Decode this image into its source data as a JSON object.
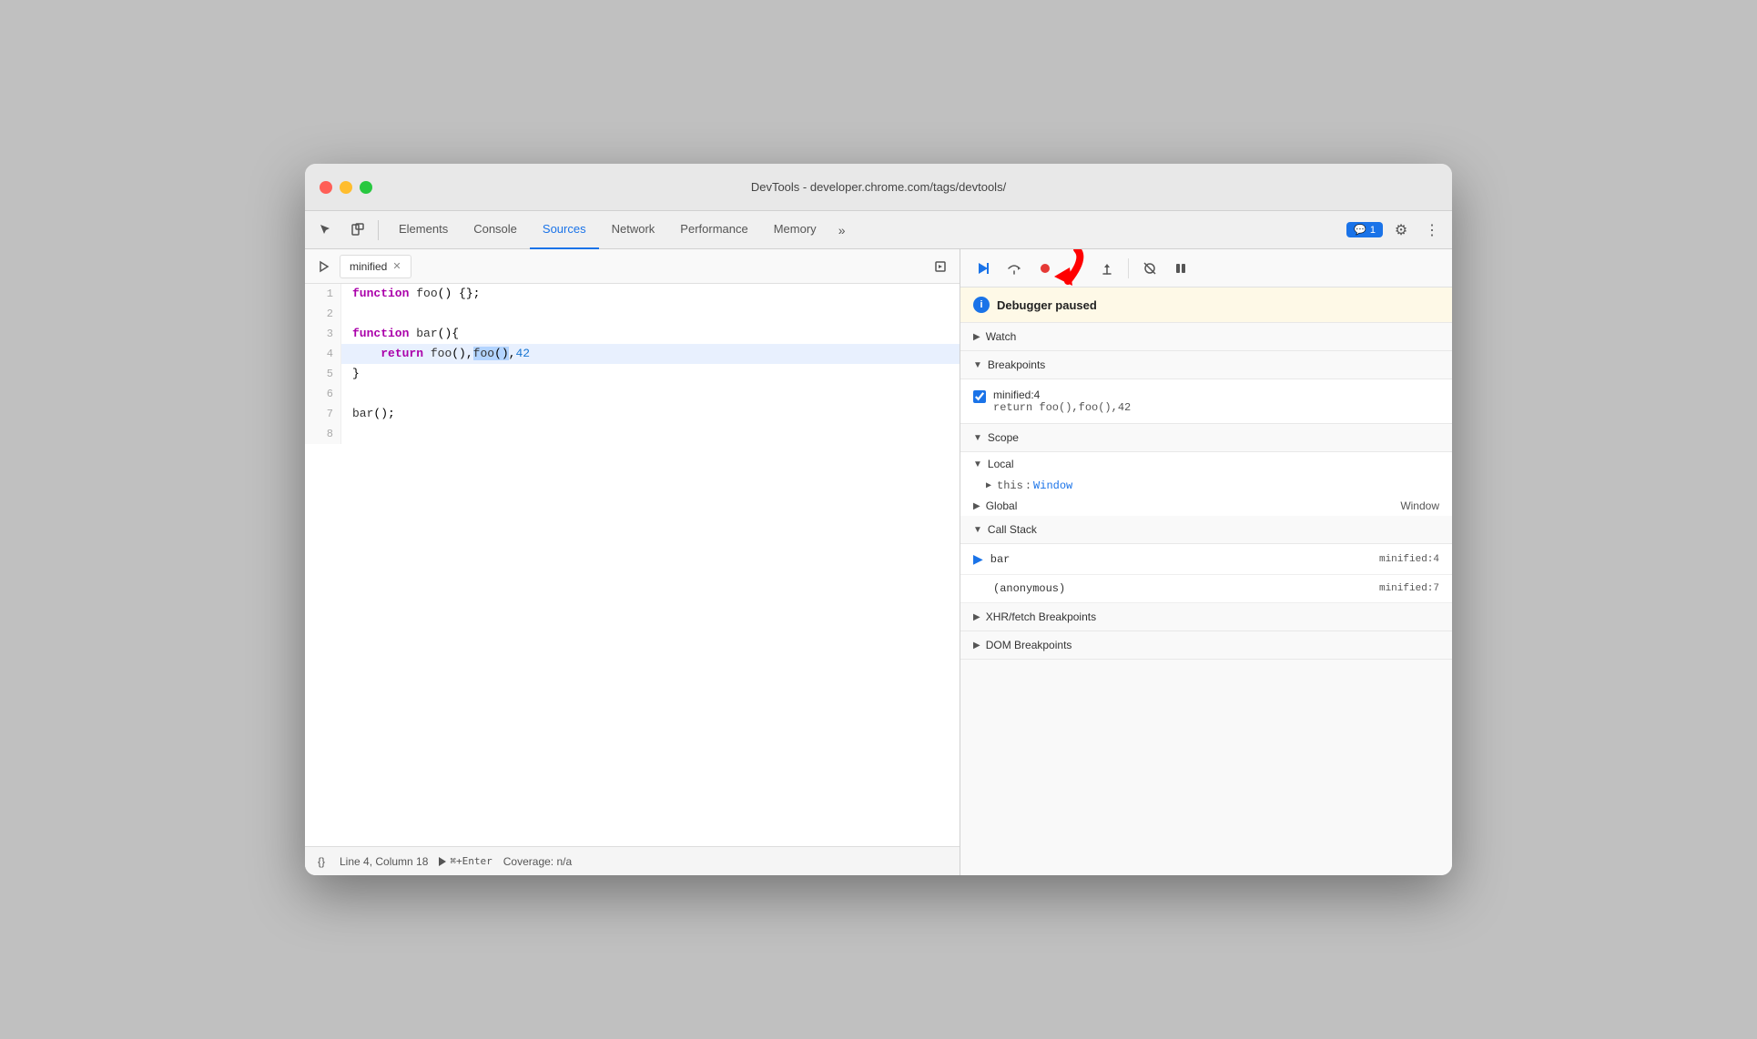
{
  "window": {
    "title": "DevTools - developer.chrome.com/tags/devtools/"
  },
  "toolbar": {
    "tabs": [
      "Elements",
      "Console",
      "Sources",
      "Network",
      "Performance",
      "Memory"
    ],
    "active_tab": "Sources",
    "more_label": "»",
    "chat_badge": "≡ 1",
    "settings_icon": "⚙",
    "more_icon": "⋮"
  },
  "sources": {
    "file_tab": "minified",
    "lines": [
      {
        "num": 1,
        "content": "function foo() {};"
      },
      {
        "num": 2,
        "content": ""
      },
      {
        "num": 3,
        "content": "function bar(){"
      },
      {
        "num": 4,
        "content": "    return foo(),foo(),42"
      },
      {
        "num": 5,
        "content": "}"
      },
      {
        "num": 6,
        "content": ""
      },
      {
        "num": 7,
        "content": "bar();"
      },
      {
        "num": 8,
        "content": ""
      }
    ],
    "status": {
      "format_icon": "{}",
      "position": "Line 4, Column 18",
      "run_label": "⌘+Enter",
      "coverage": "Coverage: n/a"
    }
  },
  "debugger": {
    "paused_message": "Debugger paused",
    "sections": {
      "watch": "Watch",
      "breakpoints": "Breakpoints",
      "scope": "Scope",
      "local": "Local",
      "global": "Global",
      "call_stack": "Call Stack",
      "xhr_breakpoints": "XHR/fetch Breakpoints",
      "dom_breakpoints": "DOM Breakpoints"
    },
    "breakpoint": {
      "location": "minified:4",
      "code": "return foo(),foo(),42"
    },
    "scope": {
      "this_val": "Window"
    },
    "global_val": "Window",
    "call_stack": [
      {
        "name": "bar",
        "location": "minified:4",
        "active": true
      },
      {
        "name": "(anonymous)",
        "location": "minified:7",
        "active": false
      }
    ]
  }
}
